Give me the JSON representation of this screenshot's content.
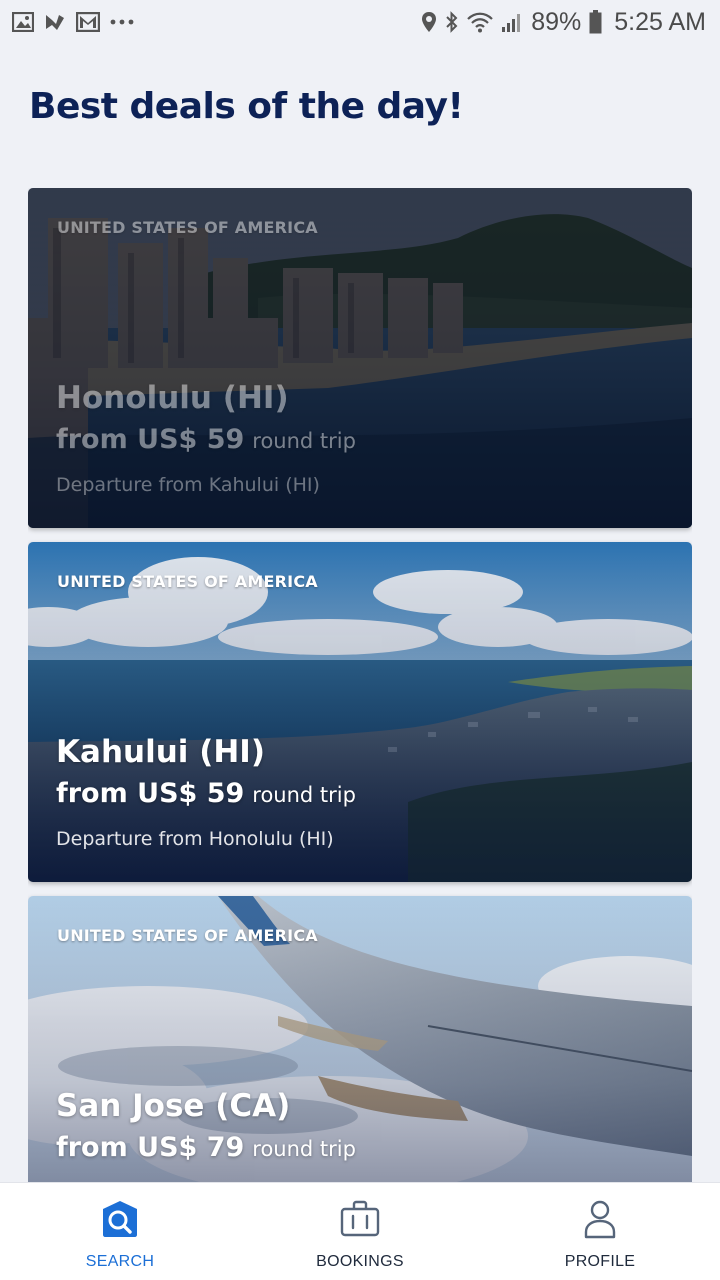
{
  "status_bar": {
    "battery": "89%",
    "time": "5:25 AM",
    "left_icons": [
      "gallery-icon",
      "missed-call-icon",
      "gmail-icon",
      "more-notifications-icon"
    ],
    "right_icons": [
      "location-icon",
      "bluetooth-icon",
      "wifi-icon",
      "signal-icon",
      "battery-icon"
    ]
  },
  "page": {
    "title": "Best deals of the day!"
  },
  "deals": [
    {
      "country": "UNITED STATES OF AMERICA",
      "city": "Honolulu (HI)",
      "price": "from US$ 59",
      "trip_type": "round trip",
      "departure": "Departure from Kahului (HI)",
      "image": "honolulu-diamond-head-photo",
      "dimmed": true
    },
    {
      "country": "UNITED STATES OF AMERICA",
      "city": "Kahului (HI)",
      "price": "from US$ 59",
      "trip_type": "round trip",
      "departure": "Departure from Honolulu (HI)",
      "image": "kahului-coast-photo",
      "dimmed": false
    },
    {
      "country": "UNITED STATES OF AMERICA",
      "city": "San Jose (CA)",
      "price": "from US$ 79",
      "trip_type": "round trip",
      "image": "airplane-wing-photo",
      "dimmed": false
    }
  ],
  "bottom_nav": {
    "items": [
      {
        "label": "SEARCH",
        "icon": "search-icon",
        "active": true
      },
      {
        "label": "BOOKINGS",
        "icon": "suitcase-icon",
        "active": false
      },
      {
        "label": "PROFILE",
        "icon": "person-icon",
        "active": false
      }
    ]
  },
  "colors": {
    "background": "#eff1f6",
    "title": "#0d2257",
    "active_nav": "#1c6fd6",
    "nav_text": "#1f2a3c"
  }
}
